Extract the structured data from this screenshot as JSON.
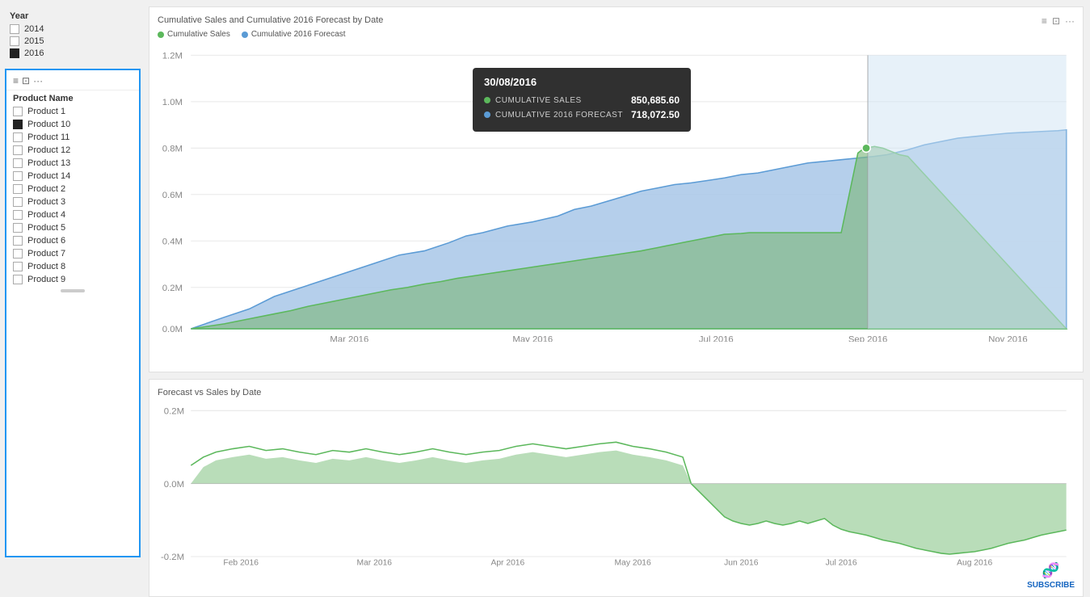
{
  "year_filter": {
    "title": "Year",
    "items": [
      {
        "label": "2014",
        "checked": false
      },
      {
        "label": "2015",
        "checked": false
      },
      {
        "label": "2016",
        "checked": true
      }
    ]
  },
  "product_filter": {
    "title": "Product Name",
    "products": [
      {
        "label": "Product 1",
        "checked": false
      },
      {
        "label": "Product 10",
        "checked": true
      },
      {
        "label": "Product 11",
        "checked": false
      },
      {
        "label": "Product 12",
        "checked": false
      },
      {
        "label": "Product 13",
        "checked": false
      },
      {
        "label": "Product 14",
        "checked": false
      },
      {
        "label": "Product 2",
        "checked": false
      },
      {
        "label": "Product 3",
        "checked": false
      },
      {
        "label": "Product 4",
        "checked": false
      },
      {
        "label": "Product 5",
        "checked": false
      },
      {
        "label": "Product 6",
        "checked": false
      },
      {
        "label": "Product 7",
        "checked": false
      },
      {
        "label": "Product 8",
        "checked": false
      },
      {
        "label": "Product 9",
        "checked": false
      }
    ]
  },
  "top_chart": {
    "title": "Cumulative Sales and Cumulative 2016 Forecast by Date",
    "legend": [
      {
        "label": "Cumulative Sales",
        "color": "#5cb85c"
      },
      {
        "label": "Cumulative 2016 Forecast",
        "color": "#5b9bd5"
      }
    ],
    "y_labels": [
      "1.2M",
      "1.0M",
      "0.8M",
      "0.6M",
      "0.4M",
      "0.2M",
      "0.0M"
    ],
    "x_labels": [
      "Mar 2016",
      "May 2016",
      "Jul 2016",
      "Sep 2016",
      "Nov 2016"
    ],
    "icons": [
      "≡",
      "⊡",
      "···"
    ]
  },
  "tooltip": {
    "date": "30/08/2016",
    "rows": [
      {
        "dot_color": "#5cb85c",
        "label": "CUMULATIVE SALES",
        "value": "850,685.60"
      },
      {
        "dot_color": "#5b9bd5",
        "label": "CUMULATIVE 2016 FORECAST",
        "value": "718,072.50"
      }
    ]
  },
  "bottom_chart": {
    "title": "Forecast vs Sales by Date",
    "y_labels": [
      "0.2M",
      "0.0M",
      "-0.2M"
    ],
    "x_labels": [
      "Feb 2016",
      "Mar 2016",
      "Apr 2016",
      "May 2016",
      "Jun 2016",
      "Jul 2016",
      "Aug 2016"
    ],
    "subscribe_label": "SUBSCRIBE"
  }
}
